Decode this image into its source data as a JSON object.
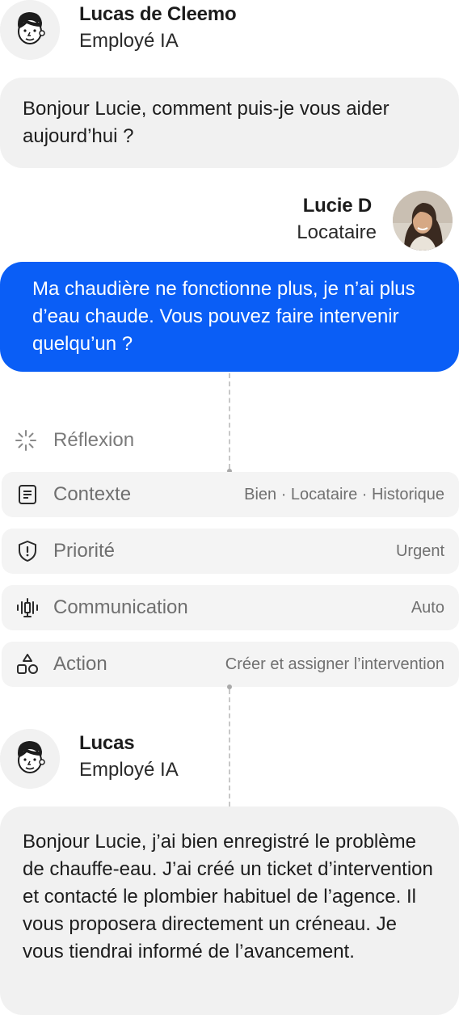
{
  "chat": {
    "agent_header": {
      "name": "Lucas de Cleemo",
      "role": "Employé IA"
    },
    "agent_message_1": "Bonjour Lucie, comment puis-je vous aider aujourd’hui ?",
    "user_header": {
      "name": "Lucie D",
      "role": "Locataire"
    },
    "user_message": "Ma chaudière ne fonctionne plus, je n’ai plus d’eau chaude. Vous pouvez faire intervenir quelqu’un ?",
    "agent_header_2": {
      "name": "Lucas",
      "role": "Employé IA"
    },
    "agent_message_2": "Bonjour Lucie, j’ai bien enregistré le problème de chauffe-eau. J’ai créé un ticket d’intervention et contacté le plombier habituel de l’agence. Il vous proposera directement un créneau. Je vous tiendrai informé de l’avancement."
  },
  "process": {
    "thinking": {
      "label": "Réflexion",
      "icon": "loader-icon"
    },
    "steps": [
      {
        "label": "Contexte",
        "value": "Bien · Locataire · Historique",
        "icon": "document-icon"
      },
      {
        "label": "Priorité",
        "value": "Urgent",
        "icon": "shield-alert-icon"
      },
      {
        "label": "Communication",
        "value": "Auto",
        "icon": "audio-wave-icon"
      },
      {
        "label": "Action",
        "value": "Créer et assigner l’intervention",
        "icon": "shapes-icon"
      }
    ]
  },
  "colors": {
    "user_bubble": "#0a5ef6",
    "agent_bubble": "#f1f1f1",
    "step_row": "#f4f4f4"
  }
}
